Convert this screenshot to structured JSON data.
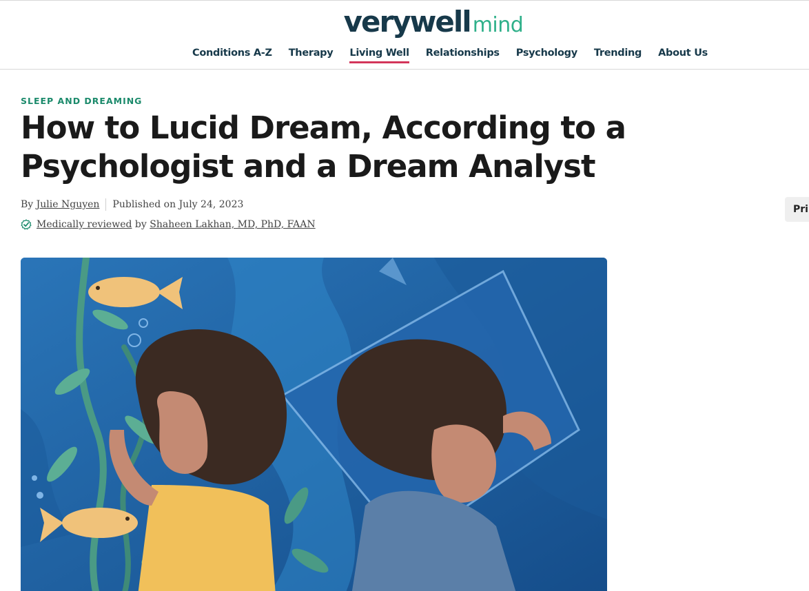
{
  "header": {
    "logo": {
      "brand": "verywell",
      "sub": "mind"
    },
    "nav": [
      {
        "label": "Conditions A-Z",
        "active": false
      },
      {
        "label": "Therapy",
        "active": false
      },
      {
        "label": "Living Well",
        "active": true
      },
      {
        "label": "Relationships",
        "active": false
      },
      {
        "label": "Psychology",
        "active": false
      },
      {
        "label": "Trending",
        "active": false
      },
      {
        "label": "About Us",
        "active": false
      }
    ]
  },
  "article": {
    "category": "SLEEP AND DREAMING",
    "title": "How to Lucid Dream, According to a Psychologist and a Dream Analyst",
    "byline": {
      "prefix": "By",
      "author": "Julie Nguyen",
      "published": "Published on July 24, 2023"
    },
    "review": {
      "link": "Medically reviewed",
      "by": "by",
      "reviewer": "Shaheen Lakhan, MD, PhD, FAAN"
    },
    "print_label": "Print",
    "hero_image": {
      "icon": "illustration-two-women-dreaming-underwater"
    }
  },
  "colors": {
    "brand_navy": "#17394a",
    "brand_green": "#2fb08a",
    "category_green": "#1b8a6b",
    "active_underline": "#d3355a",
    "check_green": "#1b8a6b"
  }
}
